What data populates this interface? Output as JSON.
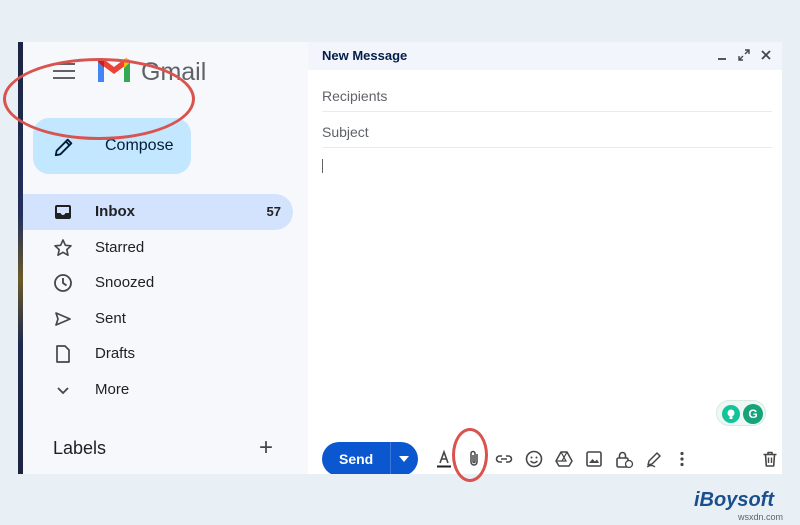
{
  "app": {
    "brand": "Gmail"
  },
  "sidebar": {
    "compose_label": "Compose",
    "items": [
      {
        "label": "Inbox",
        "count": "57",
        "icon": "inbox-icon",
        "active": true
      },
      {
        "label": "Starred",
        "icon": "star-icon"
      },
      {
        "label": "Snoozed",
        "icon": "clock-icon"
      },
      {
        "label": "Sent",
        "icon": "send-icon"
      },
      {
        "label": "Drafts",
        "icon": "draft-icon"
      },
      {
        "label": "More",
        "icon": "chevron-down-icon"
      }
    ],
    "labels_title": "Labels",
    "labels_add": "+"
  },
  "compose_window": {
    "title": "New Message",
    "recipients_placeholder": "Recipients",
    "subject_placeholder": "Subject",
    "send_label": "Send",
    "grammarly_label": "G"
  },
  "annotation_color": "#d9534f",
  "watermark": {
    "brand": "iBoysoft",
    "site": "wsxdn.com"
  }
}
